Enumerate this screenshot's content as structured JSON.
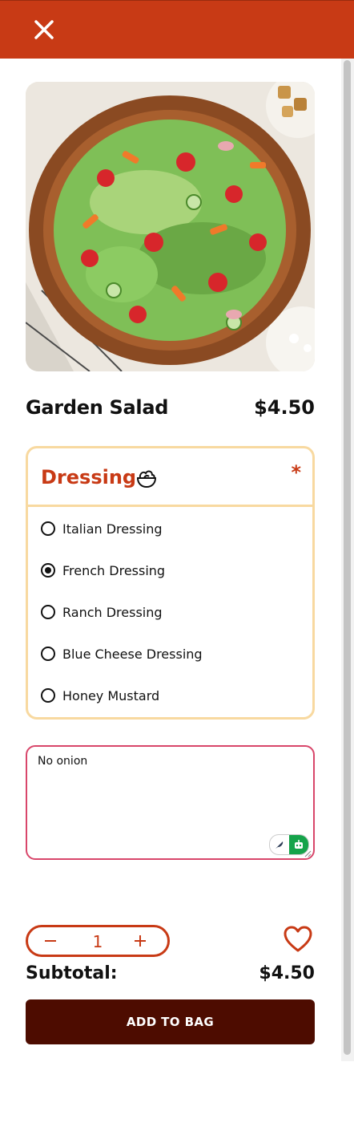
{
  "product": {
    "title": "Garden Salad",
    "price": "$4.50"
  },
  "option_group": {
    "title": "Dressing",
    "required_mark": "*",
    "options": [
      {
        "label": "Italian Dressing",
        "selected": false
      },
      {
        "label": "French Dressing",
        "selected": true
      },
      {
        "label": "Ranch Dressing",
        "selected": false
      },
      {
        "label": "Blue Cheese Dressing",
        "selected": false
      },
      {
        "label": "Honey Mustard",
        "selected": false
      }
    ]
  },
  "notes": {
    "value": "No onion"
  },
  "quantity": {
    "value": "1",
    "minus": "−",
    "plus": "+"
  },
  "subtotal": {
    "label": "Subtotal:",
    "value": "$4.50"
  },
  "cta": {
    "label": "ADD TO BAG"
  },
  "colors": {
    "brand": "#c83a15",
    "cta": "#4d0c00",
    "option_border": "#f8d9a0",
    "notes_border": "#d8466a"
  },
  "icons": {
    "close": "close-icon",
    "salad": "salad-bowl-icon",
    "heart": "heart-icon"
  }
}
